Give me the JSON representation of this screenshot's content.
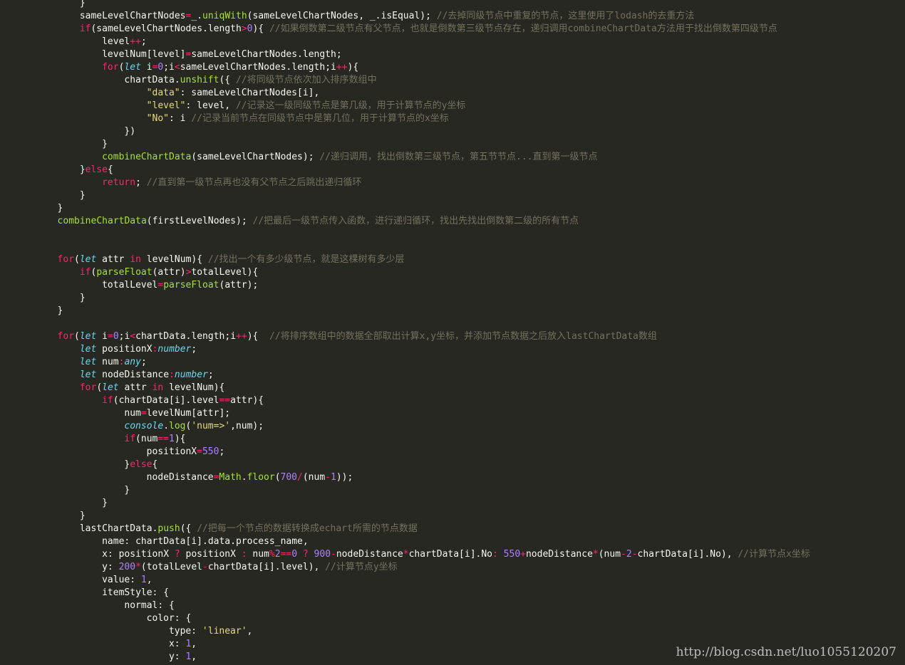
{
  "theme": {
    "background": "#272822",
    "default": "#f8f8f2",
    "keyword": "#f92672",
    "storage": "#66d9ef",
    "function": "#a6e22e",
    "number": "#ae81ff",
    "string": "#e6db74",
    "comment": "#75715e"
  },
  "lines": [
    {
      "indent": 12,
      "tokens": [
        [
          "tx",
          "}"
        ]
      ]
    },
    {
      "indent": 12,
      "tokens": [
        [
          "tx",
          "sameLevelChartNodes"
        ],
        [
          "op",
          "="
        ],
        [
          "tx",
          "_."
        ],
        [
          "fn",
          "uniqWith"
        ],
        [
          "tx",
          "(sameLevelChartNodes, _.isEqual); "
        ],
        [
          "cm",
          "//去掉同级节点中重复的节点，这里使用了lodash的去重方法"
        ]
      ]
    },
    {
      "indent": 12,
      "tokens": [
        [
          "kw",
          "if"
        ],
        [
          "tx",
          "(sameLevelChartNodes.length"
        ],
        [
          "op",
          ">"
        ],
        [
          "nm",
          "0"
        ],
        [
          "tx",
          "){ "
        ],
        [
          "cm",
          "//如果倒数第二级节点有父节点，也就是倒数第三级节点存在，递归调用combineChartData方法用于找出倒数第四级节点"
        ]
      ]
    },
    {
      "indent": 16,
      "tokens": [
        [
          "tx",
          "level"
        ],
        [
          "op",
          "++"
        ],
        [
          "tx",
          ";"
        ]
      ]
    },
    {
      "indent": 16,
      "tokens": [
        [
          "tx",
          "levelNum[level]"
        ],
        [
          "op",
          "="
        ],
        [
          "tx",
          "sameLevelChartNodes.length;"
        ]
      ]
    },
    {
      "indent": 16,
      "tokens": [
        [
          "kw",
          "for"
        ],
        [
          "tx",
          "("
        ],
        [
          "st",
          "let"
        ],
        [
          "tx",
          " i"
        ],
        [
          "op",
          "="
        ],
        [
          "nm",
          "0"
        ],
        [
          "tx",
          ";i"
        ],
        [
          "op",
          "<"
        ],
        [
          "tx",
          "sameLevelChartNodes.length;i"
        ],
        [
          "op",
          "++"
        ],
        [
          "tx",
          "){"
        ]
      ]
    },
    {
      "indent": 20,
      "tokens": [
        [
          "tx",
          "chartData."
        ],
        [
          "fn",
          "unshift"
        ],
        [
          "tx",
          "({ "
        ],
        [
          "cm",
          "//将同级节点依次加入排序数组中"
        ]
      ]
    },
    {
      "indent": 24,
      "tokens": [
        [
          "str",
          "\"data\""
        ],
        [
          "tx",
          ": sameLevelChartNodes[i],"
        ]
      ]
    },
    {
      "indent": 24,
      "tokens": [
        [
          "str",
          "\"level\""
        ],
        [
          "tx",
          ": level, "
        ],
        [
          "cm",
          "//记录这一级同级节点是第几级，用于计算节点的y坐标"
        ]
      ]
    },
    {
      "indent": 24,
      "tokens": [
        [
          "str",
          "\"No\""
        ],
        [
          "tx",
          ": i "
        ],
        [
          "cm",
          "//记录当前节点在同级节点中是第几位，用于计算节点的x坐标"
        ]
      ]
    },
    {
      "indent": 20,
      "tokens": [
        [
          "tx",
          "})"
        ]
      ]
    },
    {
      "indent": 16,
      "tokens": [
        [
          "tx",
          "}"
        ]
      ]
    },
    {
      "indent": 16,
      "tokens": [
        [
          "fn",
          "combineChartData"
        ],
        [
          "tx",
          "(sameLevelChartNodes); "
        ],
        [
          "cm",
          "//递归调用，找出倒数第三级节点，第五节节点...直到第一级节点"
        ]
      ]
    },
    {
      "indent": 12,
      "tokens": [
        [
          "tx",
          "}"
        ],
        [
          "kw",
          "else"
        ],
        [
          "tx",
          "{"
        ]
      ]
    },
    {
      "indent": 16,
      "tokens": [
        [
          "kw",
          "return"
        ],
        [
          "tx",
          "; "
        ],
        [
          "cm",
          "//直到第一级节点再也没有父节点之后跳出递归循环"
        ]
      ]
    },
    {
      "indent": 12,
      "tokens": [
        [
          "tx",
          "}"
        ]
      ]
    },
    {
      "indent": 8,
      "tokens": [
        [
          "tx",
          "}"
        ]
      ]
    },
    {
      "indent": 8,
      "tokens": [
        [
          "fn",
          "combineChartData"
        ],
        [
          "tx",
          "(firstLevelNodes); "
        ],
        [
          "cm",
          "//把最后一级节点传入函数，进行递归循环，找出先找出倒数第二级的所有节点"
        ]
      ]
    },
    {
      "indent": 0,
      "tokens": []
    },
    {
      "indent": 0,
      "tokens": []
    },
    {
      "indent": 8,
      "tokens": [
        [
          "kw",
          "for"
        ],
        [
          "tx",
          "("
        ],
        [
          "st",
          "let"
        ],
        [
          "tx",
          " attr "
        ],
        [
          "kw",
          "in"
        ],
        [
          "tx",
          " levelNum){ "
        ],
        [
          "cm",
          "//找出一个有多少级节点，就是这棵树有多少层"
        ]
      ]
    },
    {
      "indent": 12,
      "tokens": [
        [
          "kw",
          "if"
        ],
        [
          "tx",
          "("
        ],
        [
          "fn",
          "parseFloat"
        ],
        [
          "tx",
          "(attr)"
        ],
        [
          "op",
          ">"
        ],
        [
          "tx",
          "totalLevel){"
        ]
      ]
    },
    {
      "indent": 16,
      "tokens": [
        [
          "tx",
          "totalLevel"
        ],
        [
          "op",
          "="
        ],
        [
          "fn",
          "parseFloat"
        ],
        [
          "tx",
          "(attr);"
        ]
      ]
    },
    {
      "indent": 12,
      "tokens": [
        [
          "tx",
          "}"
        ]
      ]
    },
    {
      "indent": 8,
      "tokens": [
        [
          "tx",
          "}"
        ]
      ]
    },
    {
      "indent": 0,
      "tokens": []
    },
    {
      "indent": 8,
      "tokens": [
        [
          "kw",
          "for"
        ],
        [
          "tx",
          "("
        ],
        [
          "st",
          "let"
        ],
        [
          "tx",
          " i"
        ],
        [
          "op",
          "="
        ],
        [
          "nm",
          "0"
        ],
        [
          "tx",
          ";i"
        ],
        [
          "op",
          "<"
        ],
        [
          "tx",
          "chartData.length;i"
        ],
        [
          "op",
          "++"
        ],
        [
          "tx",
          "){  "
        ],
        [
          "cm",
          "//将排序数组中的数据全部取出计算x,y坐标，并添加节点数据之后放入lastChartData数组"
        ]
      ]
    },
    {
      "indent": 12,
      "tokens": [
        [
          "st",
          "let"
        ],
        [
          "tx",
          " positionX"
        ],
        [
          "op",
          ":"
        ],
        [
          "st",
          "number"
        ],
        [
          "tx",
          ";"
        ]
      ]
    },
    {
      "indent": 12,
      "tokens": [
        [
          "st",
          "let"
        ],
        [
          "tx",
          " num"
        ],
        [
          "op",
          ":"
        ],
        [
          "st",
          "any"
        ],
        [
          "tx",
          ";"
        ]
      ]
    },
    {
      "indent": 12,
      "tokens": [
        [
          "st",
          "let"
        ],
        [
          "tx",
          " nodeDistance"
        ],
        [
          "op",
          ":"
        ],
        [
          "st",
          "number"
        ],
        [
          "tx",
          ";"
        ]
      ]
    },
    {
      "indent": 12,
      "tokens": [
        [
          "kw",
          "for"
        ],
        [
          "tx",
          "("
        ],
        [
          "st",
          "let"
        ],
        [
          "tx",
          " attr "
        ],
        [
          "kw",
          "in"
        ],
        [
          "tx",
          " levelNum){"
        ]
      ]
    },
    {
      "indent": 16,
      "tokens": [
        [
          "kw",
          "if"
        ],
        [
          "tx",
          "(chartData[i].level"
        ],
        [
          "op",
          "=="
        ],
        [
          "tx",
          "attr){"
        ]
      ]
    },
    {
      "indent": 20,
      "tokens": [
        [
          "tx",
          "num"
        ],
        [
          "op",
          "="
        ],
        [
          "tx",
          "levelNum[attr];"
        ]
      ]
    },
    {
      "indent": 20,
      "tokens": [
        [
          "st",
          "console"
        ],
        [
          "tx",
          "."
        ],
        [
          "fn",
          "log"
        ],
        [
          "tx",
          "("
        ],
        [
          "str",
          "'num=>'"
        ],
        [
          "tx",
          ",num);"
        ]
      ]
    },
    {
      "indent": 20,
      "tokens": [
        [
          "kw",
          "if"
        ],
        [
          "tx",
          "(num"
        ],
        [
          "op",
          "=="
        ],
        [
          "nm",
          "1"
        ],
        [
          "tx",
          "){"
        ]
      ]
    },
    {
      "indent": 24,
      "tokens": [
        [
          "tx",
          "positionX"
        ],
        [
          "op",
          "="
        ],
        [
          "nm",
          "550"
        ],
        [
          "tx",
          ";"
        ]
      ]
    },
    {
      "indent": 20,
      "tokens": [
        [
          "tx",
          "}"
        ],
        [
          "kw",
          "else"
        ],
        [
          "tx",
          "{"
        ]
      ]
    },
    {
      "indent": 24,
      "tokens": [
        [
          "tx",
          "nodeDistance"
        ],
        [
          "op",
          "="
        ],
        [
          "fn",
          "Math"
        ],
        [
          "tx",
          "."
        ],
        [
          "fn",
          "floor"
        ],
        [
          "tx",
          "("
        ],
        [
          "nm",
          "700"
        ],
        [
          "op",
          "/"
        ],
        [
          "tx",
          "(num"
        ],
        [
          "op",
          "-"
        ],
        [
          "nm",
          "1"
        ],
        [
          "tx",
          "));"
        ]
      ]
    },
    {
      "indent": 20,
      "tokens": [
        [
          "tx",
          "}"
        ]
      ]
    },
    {
      "indent": 16,
      "tokens": [
        [
          "tx",
          "}"
        ]
      ]
    },
    {
      "indent": 12,
      "tokens": [
        [
          "tx",
          "}"
        ]
      ]
    },
    {
      "indent": 12,
      "tokens": [
        [
          "tx",
          "lastChartData."
        ],
        [
          "fn",
          "push"
        ],
        [
          "tx",
          "({ "
        ],
        [
          "cm",
          "//把每一个节点的数据转换成echart所需的节点数据"
        ]
      ]
    },
    {
      "indent": 16,
      "tokens": [
        [
          "tx",
          "name: chartData[i].data.process_name,"
        ]
      ]
    },
    {
      "indent": 16,
      "tokens": [
        [
          "tx",
          "x: positionX "
        ],
        [
          "op",
          "?"
        ],
        [
          "tx",
          " positionX "
        ],
        [
          "op",
          ":"
        ],
        [
          "tx",
          " num"
        ],
        [
          "op",
          "%"
        ],
        [
          "nm",
          "2"
        ],
        [
          "op",
          "=="
        ],
        [
          "nm",
          "0"
        ],
        [
          "tx",
          " "
        ],
        [
          "op",
          "?"
        ],
        [
          "tx",
          " "
        ],
        [
          "nm",
          "900"
        ],
        [
          "op",
          "-"
        ],
        [
          "tx",
          "nodeDistance"
        ],
        [
          "op",
          "*"
        ],
        [
          "tx",
          "chartData[i].No"
        ],
        [
          "op",
          ":"
        ],
        [
          "tx",
          " "
        ],
        [
          "nm",
          "550"
        ],
        [
          "op",
          "+"
        ],
        [
          "tx",
          "nodeDistance"
        ],
        [
          "op",
          "*"
        ],
        [
          "tx",
          "(num"
        ],
        [
          "op",
          "-"
        ],
        [
          "nm",
          "2"
        ],
        [
          "op",
          "-"
        ],
        [
          "tx",
          "chartData[i].No), "
        ],
        [
          "cm",
          "//计算节点x坐标"
        ]
      ]
    },
    {
      "indent": 16,
      "tokens": [
        [
          "tx",
          "y: "
        ],
        [
          "nm",
          "200"
        ],
        [
          "op",
          "*"
        ],
        [
          "tx",
          "(totalLevel"
        ],
        [
          "op",
          "-"
        ],
        [
          "tx",
          "chartData[i].level), "
        ],
        [
          "cm",
          "//计算节点y坐标"
        ]
      ]
    },
    {
      "indent": 16,
      "tokens": [
        [
          "tx",
          "value: "
        ],
        [
          "nm",
          "1"
        ],
        [
          "tx",
          ","
        ]
      ]
    },
    {
      "indent": 16,
      "tokens": [
        [
          "tx",
          "itemStyle: {"
        ]
      ]
    },
    {
      "indent": 20,
      "tokens": [
        [
          "tx",
          "normal: {"
        ]
      ]
    },
    {
      "indent": 24,
      "tokens": [
        [
          "tx",
          "color: {"
        ]
      ]
    },
    {
      "indent": 28,
      "tokens": [
        [
          "tx",
          "type: "
        ],
        [
          "str",
          "'linear'"
        ],
        [
          "tx",
          ","
        ]
      ]
    },
    {
      "indent": 28,
      "tokens": [
        [
          "tx",
          "x: "
        ],
        [
          "nm",
          "1"
        ],
        [
          "tx",
          ","
        ]
      ]
    },
    {
      "indent": 28,
      "tokens": [
        [
          "tx",
          "y: "
        ],
        [
          "nm",
          "1"
        ],
        [
          "tx",
          ","
        ]
      ]
    }
  ],
  "watermark": "http://blog.csdn.net/luo1055120207"
}
